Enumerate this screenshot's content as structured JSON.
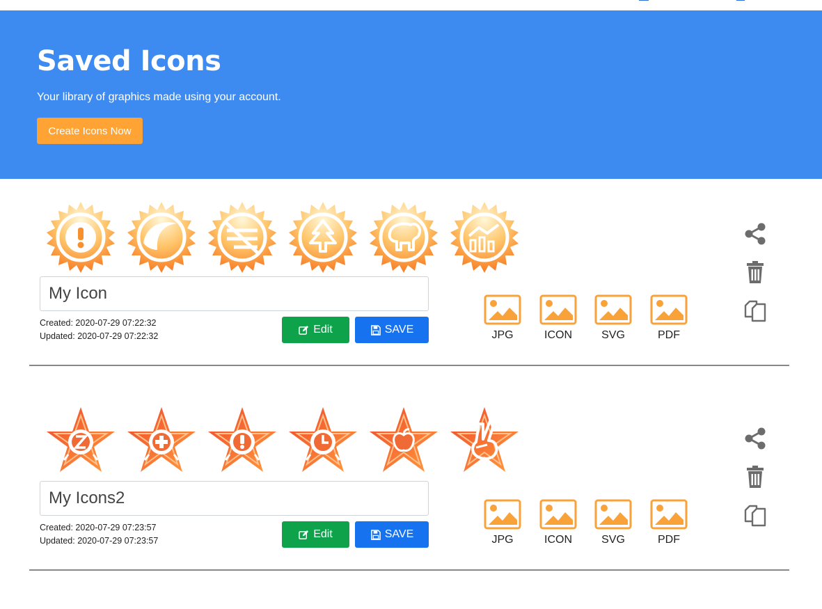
{
  "hero": {
    "title": "Saved Icons",
    "subtitle": "Your library of graphics made using your account.",
    "cta_label": "Create Icons Now"
  },
  "colors": {
    "hero_bg": "#3d8af0",
    "cta": "#ffa335",
    "edit": "#0ea34a",
    "save": "#1672ee",
    "format_icon": "#f9a23a",
    "action_icon": "#6c6c6c"
  },
  "sets": [
    {
      "name": "My Icon",
      "created": "Created: 2020-07-29 07:22:32",
      "updated": "Updated: 2020-07-29 07:22:32",
      "edit_label": "Edit",
      "save_label": "SAVE",
      "badge_shape": "sunburst-badge",
      "icons": [
        "exclamation-icon",
        "crescent-icon",
        "no-lines-icon",
        "tree-icon",
        "elephant-icon",
        "chart-icon"
      ],
      "formats": [
        "JPG",
        "ICON",
        "SVG",
        "PDF"
      ]
    },
    {
      "name": "My Icons2",
      "created": "Created: 2020-07-29 07:23:57",
      "updated": "Updated: 2020-07-29 07:23:57",
      "edit_label": "Edit",
      "save_label": "SAVE",
      "badge_shape": "star-badge",
      "icons": [
        "z-circle-icon",
        "plus-circle-icon",
        "exclamation-icon",
        "clock-icon",
        "apple-icon",
        "peace-hand-icon"
      ],
      "formats": [
        "JPG",
        "ICON",
        "SVG",
        "PDF"
      ]
    }
  ],
  "actions": [
    "share-icon",
    "trash-icon",
    "copy-icon"
  ]
}
